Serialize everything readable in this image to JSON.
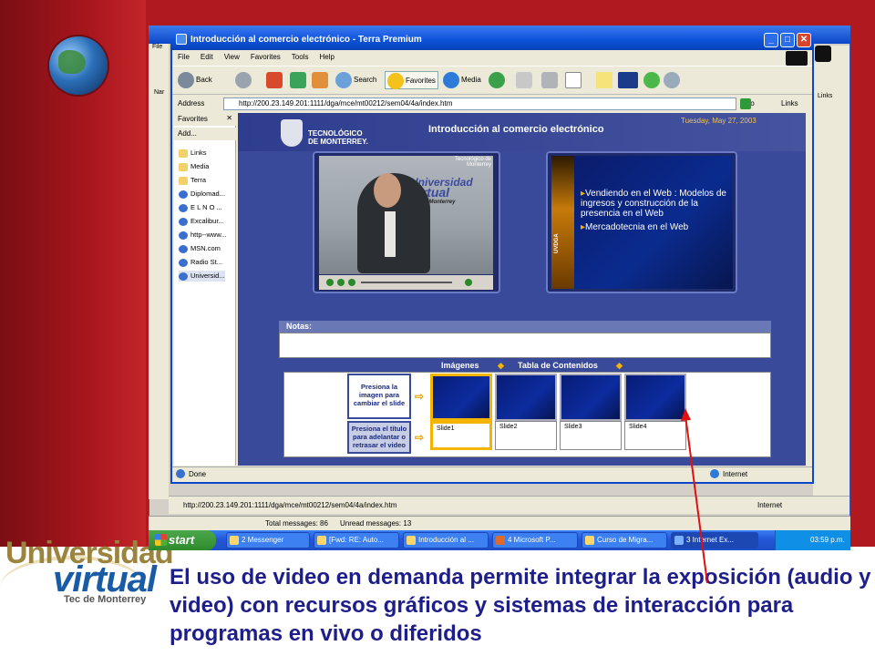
{
  "caption": "El uso de video en demanda permite integrar la exposición (audio y video) con recursos gráficos y sistemas de interacción  para programas en vivo o diferidos",
  "logo": {
    "line1": "Universidad",
    "line2": "virtual",
    "line3": "Tec de Monterrey"
  },
  "outer_window": {
    "address": "http://200.23.149.201:1111/dga/mce/mt00212/sem04/4a/index.htm",
    "status_internet": "Internet",
    "total_messages": "Total messages: 86",
    "unread_messages": "Unread messages: 13",
    "links_label": "Links",
    "file_menu": "File",
    "nar_label": "Nar"
  },
  "ie": {
    "title": "Introducción al comercio electrónico - Terra Premium",
    "menu": [
      "File",
      "Edit",
      "View",
      "Favorites",
      "Tools",
      "Help"
    ],
    "toolbar": {
      "back": "Back",
      "search": "Search",
      "favorites": "Favorites",
      "media": "Media"
    },
    "address_label": "Address",
    "address": "http://200.23.149.201:1111/dga/mce/mt00212/sem04/4a/index.htm",
    "go": "Go",
    "links": "Links",
    "status_done": "Done",
    "status_zone": "Internet"
  },
  "favorites": {
    "title": "Favorites",
    "add": "Add...",
    "items": [
      "Links",
      "Media",
      "Terra",
      "Diplomad...",
      "E L  N O ...",
      "Excalibur...",
      "http--www...",
      "MSN.com",
      "Radio St...",
      "Universid..."
    ]
  },
  "page": {
    "tec_line1": "TECNOLÓGICO",
    "tec_line2": "DE MONTERREY.",
    "title": "Introducción al comercio electrónico",
    "date": "Tuesday, May 27, 2003",
    "video_logo_1": "Universidad",
    "video_logo_2": "Virtual",
    "video_logo_3": "Tec de Monterrey",
    "video_corner": "Tecnológico de Monterrey",
    "slide_bullets": [
      "Vendiendo en el Web : Modelos de ingresos y construcción de la presencia en el Web",
      "Mercadotecnia en el Web"
    ],
    "slide_brand": "UVDGA",
    "notas": "Notas:",
    "tab_images": "Imágenes",
    "tab_contents": "Tabla de Contenidos",
    "instr1": "Presiona la imagen para cambiar el slide",
    "instr2": "Presiona el título para adelantar o retrasar el video",
    "slides": [
      "Slide1",
      "Slide2",
      "Slide3",
      "Slide4"
    ]
  },
  "taskbar": {
    "start": "start",
    "tasks": [
      "2 Messenger",
      "[Fwd: RE: Auto...",
      "Introducción al ...",
      "4 Microsoft P...",
      "Curso de Migra...",
      "3 Internet Ex..."
    ],
    "clock": "03:59 p.m."
  },
  "colors": {
    "accent_red": "#b01a1f",
    "page_blue": "#3a4a9a",
    "slide_gold": "#f4b400",
    "caption_blue": "#1e1e8a"
  }
}
